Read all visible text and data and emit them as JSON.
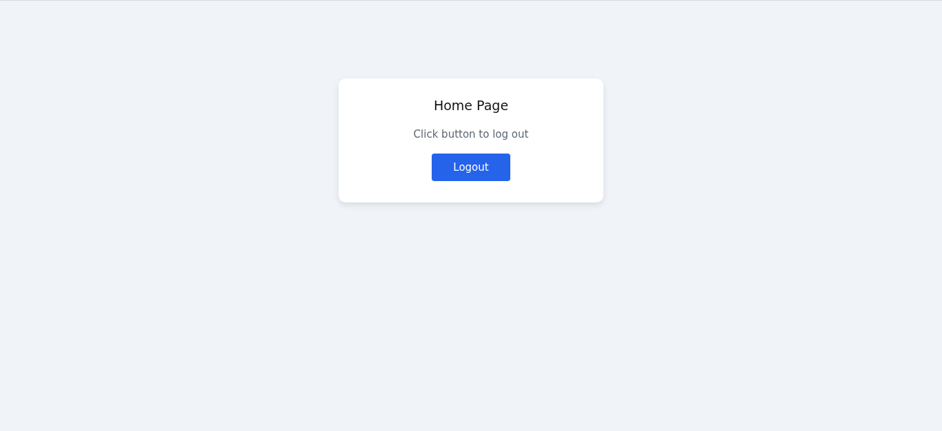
{
  "card": {
    "title": "Home Page",
    "message": "Click button to log out",
    "button": "Logout"
  }
}
